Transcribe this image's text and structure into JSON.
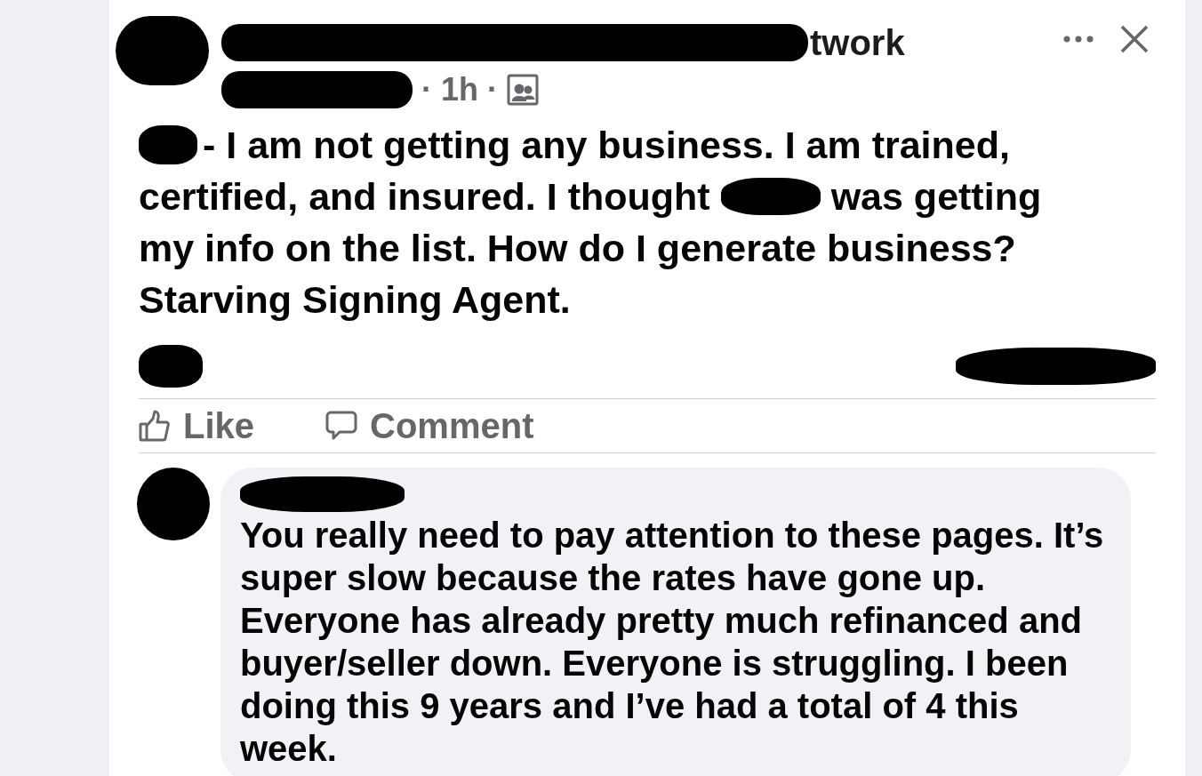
{
  "post": {
    "group_title_visible": "twork",
    "time": "1h",
    "separator": "·",
    "body_lines": [
      [
        {
          "kind": "redacted"
        },
        {
          "kind": "text",
          "text": "- I am not getting any business. I am trained,"
        }
      ],
      [
        {
          "kind": "text",
          "text": "certified, and insured. I thought"
        },
        {
          "kind": "redacted"
        },
        {
          "kind": "text",
          "text": "was getting"
        }
      ],
      [
        {
          "kind": "text",
          "text": "my info on the list. How do I generate business?"
        }
      ],
      [
        {
          "kind": "text",
          "text": "Starving Signing Agent."
        }
      ]
    ],
    "actions": [
      {
        "kind": "like",
        "label": "Like"
      },
      {
        "kind": "comment",
        "label": "Comment"
      }
    ]
  },
  "comment": {
    "text": "You really need to pay attention to these pages. It’s super slow because the rates have gone up. Everyone has already pretty much refinanced and buyer/seller down. Everyone is struggling. I been doing this 9 years and I’ve had a total of 4 this week."
  }
}
